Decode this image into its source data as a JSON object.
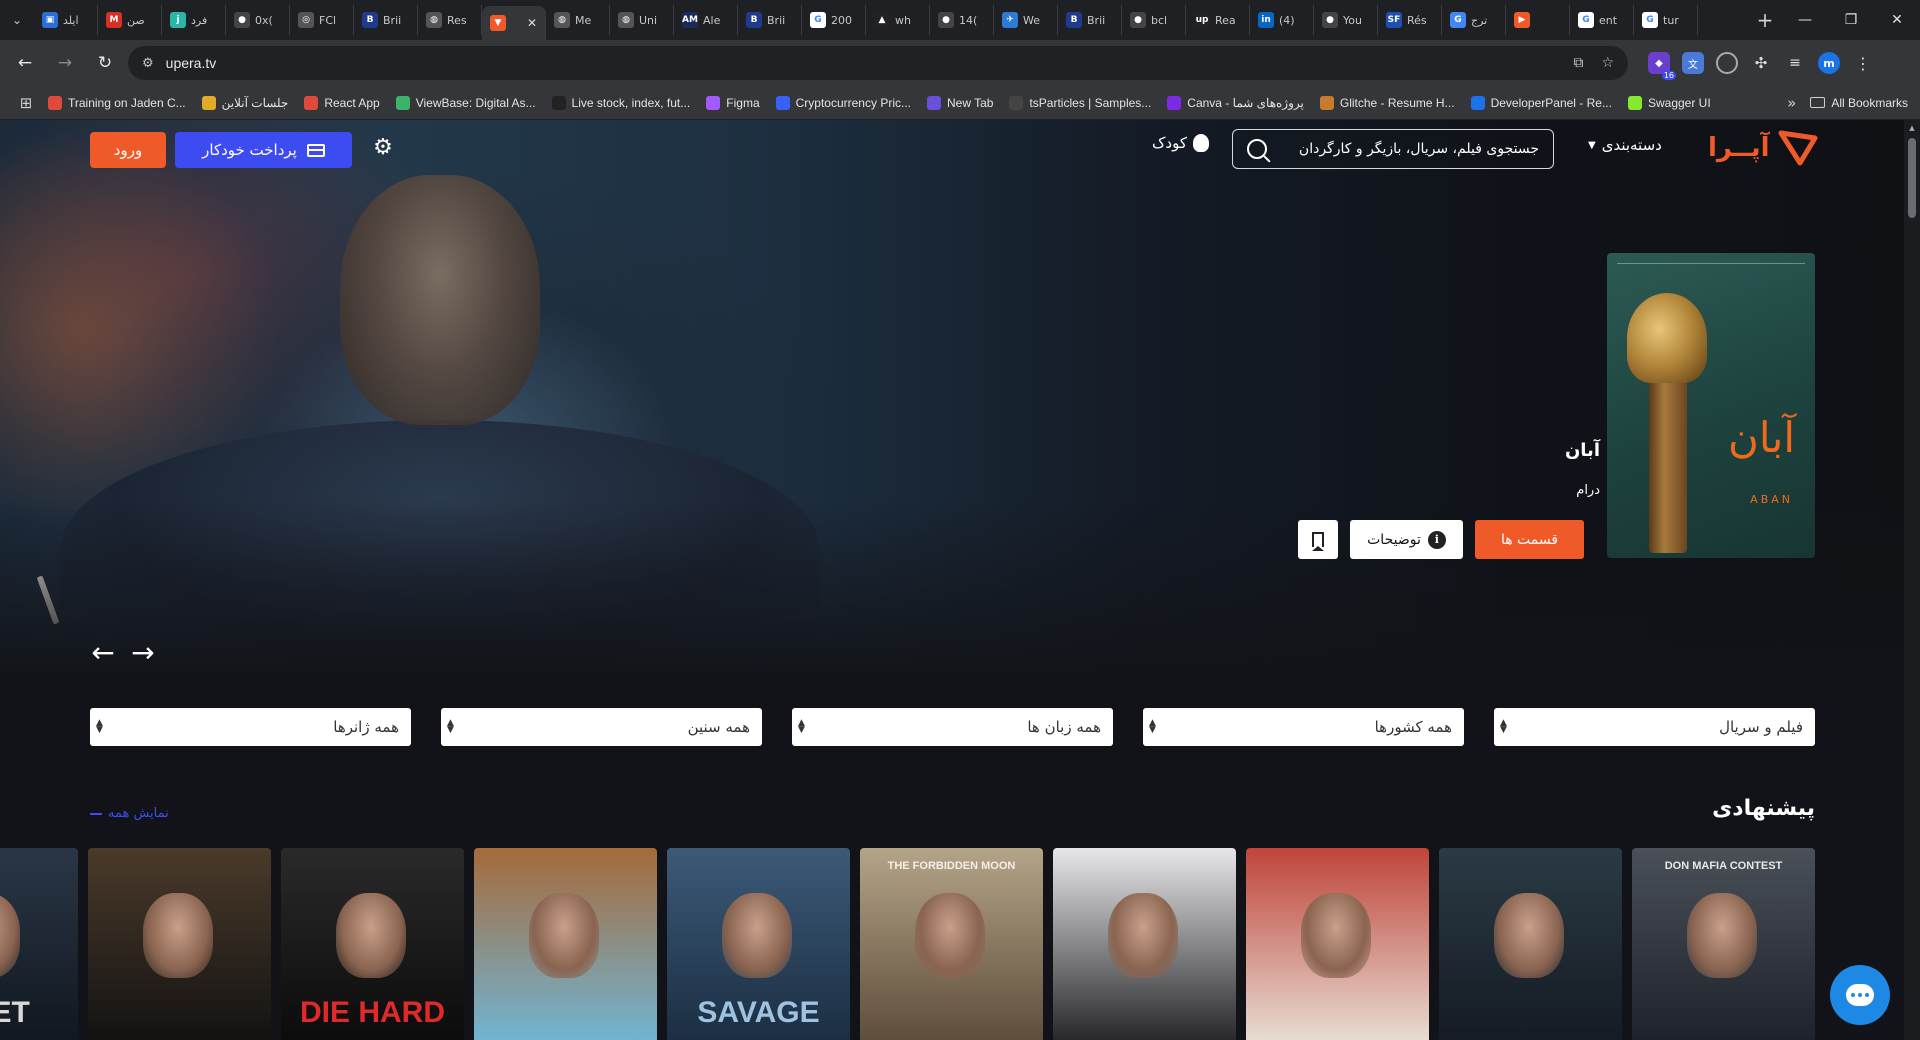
{
  "browser": {
    "tabs": [
      {
        "title": "ایلد",
        "color": "#2b6fd6",
        "glyph": "▣"
      },
      {
        "title": "صن",
        "color": "#d93025",
        "glyph": "M"
      },
      {
        "title": "فرد",
        "color": "#2bb5a8",
        "glyph": "j"
      },
      {
        "title": "0x(",
        "color": "#444",
        "glyph": "●"
      },
      {
        "title": "FCl",
        "color": "#555",
        "glyph": "◎"
      },
      {
        "title": "Brii",
        "color": "#1f3a8a",
        "glyph": "B"
      },
      {
        "title": "Res",
        "color": "#555",
        "glyph": "◍"
      },
      {
        "title": "",
        "color": "#f05a28",
        "glyph": "▼",
        "active": true
      },
      {
        "title": "Me",
        "color": "#555",
        "glyph": "◍"
      },
      {
        "title": "Uni",
        "color": "#555",
        "glyph": "◍"
      },
      {
        "title": "Ale",
        "color": "#1a2a5a",
        "glyph": "AM"
      },
      {
        "title": "Brii",
        "color": "#1f3a8a",
        "glyph": "B"
      },
      {
        "title": "200",
        "color": "#fff",
        "glyph": "G"
      },
      {
        "title": "wh",
        "color": "#222",
        "glyph": "▲"
      },
      {
        "title": "14(",
        "color": "#444",
        "glyph": "●"
      },
      {
        "title": "We",
        "color": "#2e7bd6",
        "glyph": "✈"
      },
      {
        "title": "Brii",
        "color": "#1f3a8a",
        "glyph": "B"
      },
      {
        "title": "bcl",
        "color": "#444",
        "glyph": "●"
      },
      {
        "title": "Rea",
        "color": "#222",
        "glyph": "up"
      },
      {
        "title": "(4)",
        "color": "#0a66c2",
        "glyph": "in"
      },
      {
        "title": "You",
        "color": "#444",
        "glyph": "●"
      },
      {
        "title": "Rés",
        "color": "#1f4fb0",
        "glyph": "SF"
      },
      {
        "title": "ترج",
        "color": "#4285f4",
        "glyph": "G"
      },
      {
        "title": "",
        "color": "#f05a28",
        "glyph": "▶"
      },
      {
        "title": "ent",
        "color": "#fff",
        "glyph": "G"
      },
      {
        "title": "tur",
        "color": "#fff",
        "glyph": "G"
      }
    ],
    "url": "upera.tv",
    "bookmarks": [
      {
        "label": "Training on Jaden C...",
        "color": "#e04a3a"
      },
      {
        "label": "جلسات آنلاین",
        "color": "#e3a92b"
      },
      {
        "label": "React App",
        "color": "#e04a3a"
      },
      {
        "label": "ViewBase: Digital As...",
        "color": "#3bb36a"
      },
      {
        "label": "Live stock, index, fut...",
        "color": "#222"
      },
      {
        "label": "Figma",
        "color": "#a259ff"
      },
      {
        "label": "Cryptocurrency Pric...",
        "color": "#3861fb"
      },
      {
        "label": "New Tab",
        "color": "#6b4fd8"
      },
      {
        "label": "tsParticles | Samples...",
        "color": "#444"
      },
      {
        "label": "Canva - پروژه‌های شما",
        "color": "#7d2ae8"
      },
      {
        "label": "Glitche - Resume H...",
        "color": "#c87b2a"
      },
      {
        "label": "DeveloperPanel - Re...",
        "color": "#1a73e8"
      },
      {
        "label": "Swagger UI",
        "color": "#85ea2d"
      }
    ],
    "all_bookmarks": "All Bookmarks",
    "profile_initial": "m",
    "extension_badge": "16"
  },
  "header": {
    "logo_text": "آپــرا",
    "categories_label": "دسته‌بندی",
    "search_placeholder": "جستجوی فیلم، سریال، بازیگر و کارگردان",
    "kids_label": "کودک",
    "autopay_label": "پرداخت خودکار",
    "login_label": "ورود"
  },
  "hero": {
    "title": "آبان",
    "genre": "درام",
    "poster_title": "آبان",
    "poster_subtitle": "ABAN",
    "episodes_label": "قسمت ها",
    "description_label": "توضیحات",
    "prev_arrow": "←",
    "next_arrow": "→"
  },
  "filters": [
    {
      "label": "فیلم و سریال"
    },
    {
      "label": "همه کشورها"
    },
    {
      "label": "همه زبان ها"
    },
    {
      "label": "همه سنین"
    },
    {
      "label": "همه ژانرها"
    }
  ],
  "recommended": {
    "title": "پیشنهادی",
    "show_all": "نمایش همه",
    "cards": [
      {
        "caption": "DON MAFIA CONTEST",
        "bg1": "#4a5058",
        "bg2": "#1c2028",
        "captionColor": "#e8e8e8"
      },
      {
        "caption": "",
        "bg1": "#2a3a45",
        "bg2": "#141a22",
        "captionColor": "#fff"
      },
      {
        "caption": "",
        "bg1": "#c0443a",
        "bg2": "#e9e2d8",
        "captionColor": "#fff"
      },
      {
        "caption": "",
        "bg1": "#e8e8ea",
        "bg2": "#202022",
        "captionColor": "#fff"
      },
      {
        "caption": "THE FORBIDDEN MOON",
        "bg1": "#b4a488",
        "bg2": "#5a4a38",
        "captionColor": "#f4efe6"
      },
      {
        "caption": "SAVAGE",
        "bg1": "#3c5a78",
        "bg2": "#1a2c40",
        "captionColor": "#9ec2e0"
      },
      {
        "caption": "",
        "bg1": "#a66a3a",
        "bg2": "#6fb7d8",
        "captionColor": "#fff"
      },
      {
        "caption": "DIE HARD",
        "bg1": "#2a2a2a",
        "bg2": "#0a0a0a",
        "captionColor": "#e02a2a"
      },
      {
        "caption": "",
        "bg1": "#4a3a2a",
        "bg2": "#111",
        "captionColor": "#fff"
      },
      {
        "caption": "BILET",
        "bg1": "#2a3646",
        "bg2": "#10161e",
        "captionColor": "#d8d8d8"
      }
    ]
  },
  "colors": {
    "accent_orange": "#f05a28",
    "accent_blue": "#3c4cf0",
    "chat_blue": "#1e88e5"
  }
}
